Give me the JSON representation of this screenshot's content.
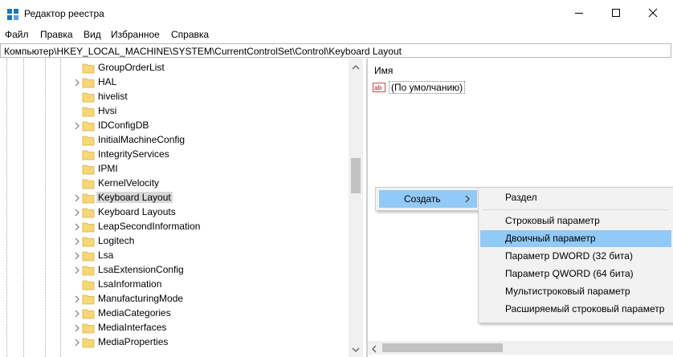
{
  "window": {
    "title": "Редактор реестра"
  },
  "menu": [
    "Файл",
    "Правка",
    "Вид",
    "Избранное",
    "Справка"
  ],
  "address": "Компьютер\\HKEY_LOCAL_MACHINE\\SYSTEM\\CurrentControlSet\\Control\\Keyboard Layout",
  "tree": [
    {
      "label": "GroupOrderList",
      "expandable": false
    },
    {
      "label": "HAL",
      "expandable": true
    },
    {
      "label": "hivelist",
      "expandable": false
    },
    {
      "label": "Hvsi",
      "expandable": false
    },
    {
      "label": "IDConfigDB",
      "expandable": true
    },
    {
      "label": "InitialMachineConfig",
      "expandable": false
    },
    {
      "label": "IntegrityServices",
      "expandable": false
    },
    {
      "label": "IPMI",
      "expandable": false
    },
    {
      "label": "KernelVelocity",
      "expandable": false
    },
    {
      "label": "Keyboard Layout",
      "expandable": true,
      "selected": true
    },
    {
      "label": "Keyboard Layouts",
      "expandable": true
    },
    {
      "label": "LeapSecondInformation",
      "expandable": true
    },
    {
      "label": "Logitech",
      "expandable": true
    },
    {
      "label": "Lsa",
      "expandable": true
    },
    {
      "label": "LsaExtensionConfig",
      "expandable": true
    },
    {
      "label": "LsaInformation",
      "expandable": false
    },
    {
      "label": "ManufacturingMode",
      "expandable": true
    },
    {
      "label": "MediaCategories",
      "expandable": true
    },
    {
      "label": "MediaInterfaces",
      "expandable": true
    },
    {
      "label": "MediaProperties",
      "expandable": true
    }
  ],
  "values_pane": {
    "column_name": "Имя",
    "rows": [
      {
        "name": "(По умолчанию)",
        "icon": "ab-string-icon"
      }
    ]
  },
  "context_menu": {
    "create_label": "Создать"
  },
  "submenu": {
    "items": [
      {
        "label": "Раздел"
      },
      {
        "label": "Строковый параметр"
      },
      {
        "label": "Двоичный параметр",
        "highlighted": true
      },
      {
        "label": "Параметр DWORD (32 бита)"
      },
      {
        "label": "Параметр QWORD (64 бита)"
      },
      {
        "label": "Мультистроковый параметр"
      },
      {
        "label": "Расширяемый строковый параметр"
      }
    ]
  },
  "colors": {
    "highlight": "#91c9f7",
    "folder": "#f8d775",
    "selection": "#d9d9d9"
  }
}
